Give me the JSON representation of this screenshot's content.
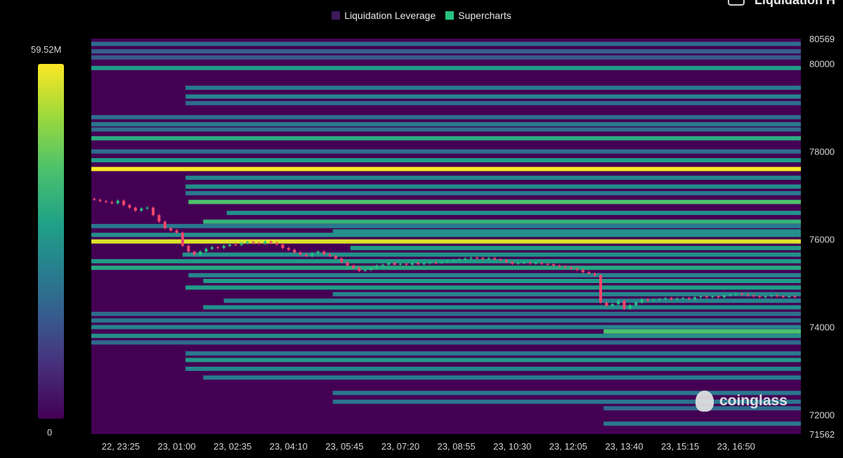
{
  "legend": [
    {
      "label": "Liquidation Leverage",
      "color": "#3d1a5c"
    },
    {
      "label": "Supercharts",
      "color": "#26c281"
    }
  ],
  "corner_title": "Liquidation H",
  "color_scale": {
    "max_label": "59.52M",
    "min_label": "0"
  },
  "watermark": "coinglass",
  "colors": {
    "background": "#440154",
    "candle_up": "#26c281",
    "candle_down": "#f0476b",
    "band_low": "#365c8d",
    "band_mid": "#1fa187",
    "band_high": "#fde725"
  },
  "chart_data": {
    "type": "heatmap",
    "x_ticks": [
      "22, 23:25",
      "23, 01:00",
      "23, 02:35",
      "23, 04:10",
      "23, 05:45",
      "23, 07:20",
      "23, 08:55",
      "23, 10:30",
      "23, 12:05",
      "23, 13:40",
      "23, 15:15",
      "23, 16:50"
    ],
    "y_ticks": [
      80569,
      80000,
      78000,
      76000,
      74000,
      72000,
      71562
    ],
    "ylim": [
      71562,
      80569
    ],
    "x_range_minutes": [
      -50,
      1155
    ],
    "candles_close": [
      [
        -45,
        76900
      ],
      [
        -35,
        76870
      ],
      [
        -25,
        76850
      ],
      [
        -15,
        76820
      ],
      [
        -5,
        76880
      ],
      [
        5,
        76780
      ],
      [
        15,
        76720
      ],
      [
        25,
        76650
      ],
      [
        35,
        76700
      ],
      [
        45,
        76720
      ],
      [
        55,
        76550
      ],
      [
        65,
        76400
      ],
      [
        75,
        76250
      ],
      [
        85,
        76200
      ],
      [
        95,
        76150
      ],
      [
        105,
        75850
      ],
      [
        115,
        75720
      ],
      [
        125,
        75650
      ],
      [
        135,
        75720
      ],
      [
        145,
        75780
      ],
      [
        155,
        75820
      ],
      [
        165,
        75800
      ],
      [
        175,
        75850
      ],
      [
        185,
        75880
      ],
      [
        195,
        75870
      ],
      [
        205,
        75910
      ],
      [
        215,
        75940
      ],
      [
        225,
        75920
      ],
      [
        235,
        75900
      ],
      [
        245,
        75950
      ],
      [
        255,
        75920
      ],
      [
        265,
        75880
      ],
      [
        275,
        75800
      ],
      [
        285,
        75760
      ],
      [
        295,
        75700
      ],
      [
        305,
        75650
      ],
      [
        315,
        75620
      ],
      [
        325,
        75680
      ],
      [
        335,
        75720
      ],
      [
        345,
        75660
      ],
      [
        355,
        75620
      ],
      [
        365,
        75560
      ],
      [
        375,
        75480
      ],
      [
        385,
        75400
      ],
      [
        395,
        75350
      ],
      [
        405,
        75280
      ],
      [
        415,
        75300
      ],
      [
        425,
        75350
      ],
      [
        435,
        75400
      ],
      [
        445,
        75420
      ],
      [
        455,
        75460
      ],
      [
        465,
        75420
      ],
      [
        475,
        75440
      ],
      [
        485,
        75420
      ],
      [
        495,
        75460
      ],
      [
        505,
        75430
      ],
      [
        515,
        75450
      ],
      [
        525,
        75470
      ],
      [
        535,
        75460
      ],
      [
        545,
        75480
      ],
      [
        555,
        75500
      ],
      [
        565,
        75520
      ],
      [
        575,
        75540
      ],
      [
        585,
        75560
      ],
      [
        595,
        75580
      ],
      [
        605,
        75570
      ],
      [
        615,
        75550
      ],
      [
        625,
        75570
      ],
      [
        635,
        75540
      ],
      [
        645,
        75520
      ],
      [
        655,
        75480
      ],
      [
        665,
        75440
      ],
      [
        675,
        75460
      ],
      [
        685,
        75470
      ],
      [
        695,
        75450
      ],
      [
        705,
        75460
      ],
      [
        715,
        75440
      ],
      [
        725,
        75430
      ],
      [
        735,
        75400
      ],
      [
        745,
        75380
      ],
      [
        755,
        75360
      ],
      [
        765,
        75330
      ],
      [
        775,
        75300
      ],
      [
        785,
        75250
      ],
      [
        795,
        75220
      ],
      [
        805,
        75180
      ],
      [
        815,
        74560
      ],
      [
        825,
        74480
      ],
      [
        835,
        74520
      ],
      [
        845,
        74600
      ],
      [
        855,
        74420
      ],
      [
        865,
        74500
      ],
      [
        875,
        74560
      ],
      [
        885,
        74630
      ],
      [
        895,
        74600
      ],
      [
        905,
        74620
      ],
      [
        915,
        74640
      ],
      [
        925,
        74660
      ],
      [
        935,
        74630
      ],
      [
        945,
        74650
      ],
      [
        955,
        74660
      ],
      [
        965,
        74640
      ],
      [
        975,
        74680
      ],
      [
        985,
        74700
      ],
      [
        995,
        74680
      ],
      [
        1005,
        74700
      ],
      [
        1015,
        74680
      ],
      [
        1025,
        74720
      ],
      [
        1035,
        74740
      ],
      [
        1045,
        74760
      ],
      [
        1055,
        74740
      ],
      [
        1065,
        74720
      ],
      [
        1075,
        74700
      ],
      [
        1085,
        74680
      ],
      [
        1095,
        74700
      ],
      [
        1105,
        74720
      ],
      [
        1115,
        74700
      ],
      [
        1125,
        74690
      ],
      [
        1135,
        74700
      ],
      [
        1145,
        74690
      ]
    ],
    "bands": [
      {
        "price": 80450,
        "start": -50,
        "level": 0.35
      },
      {
        "price": 80280,
        "start": -50,
        "level": 0.3
      },
      {
        "price": 80140,
        "start": -50,
        "level": 0.28
      },
      {
        "price": 79900,
        "start": -50,
        "level": 0.55
      },
      {
        "price": 79450,
        "start": 110,
        "level": 0.4
      },
      {
        "price": 79250,
        "start": 110,
        "level": 0.45
      },
      {
        "price": 79100,
        "start": 110,
        "level": 0.35
      },
      {
        "price": 78780,
        "start": -50,
        "level": 0.35
      },
      {
        "price": 78620,
        "start": -50,
        "level": 0.4
      },
      {
        "price": 78500,
        "start": -50,
        "level": 0.35
      },
      {
        "price": 78300,
        "start": -50,
        "level": 0.62
      },
      {
        "price": 78000,
        "start": -50,
        "level": 0.35
      },
      {
        "price": 77800,
        "start": -50,
        "level": 0.55
      },
      {
        "price": 77600,
        "start": -50,
        "level": 1.0
      },
      {
        "price": 77400,
        "start": 110,
        "level": 0.45
      },
      {
        "price": 77200,
        "start": 110,
        "level": 0.5
      },
      {
        "price": 77050,
        "start": 110,
        "level": 0.4
      },
      {
        "price": 76850,
        "start": 115,
        "level": 0.72
      },
      {
        "price": 76600,
        "start": 180,
        "level": 0.5
      },
      {
        "price": 76400,
        "start": 140,
        "level": 0.65
      },
      {
        "price": 76300,
        "start": -50,
        "level": 0.4
      },
      {
        "price": 76180,
        "start": 360,
        "level": 0.5
      },
      {
        "price": 76100,
        "start": -50,
        "level": 0.5
      },
      {
        "price": 75950,
        "start": -50,
        "level": 0.95
      },
      {
        "price": 75800,
        "start": 390,
        "level": 0.55
      },
      {
        "price": 75650,
        "start": 105,
        "level": 0.5
      },
      {
        "price": 75500,
        "start": -50,
        "level": 0.55
      },
      {
        "price": 75350,
        "start": -50,
        "level": 0.6
      },
      {
        "price": 75180,
        "start": 115,
        "level": 0.45
      },
      {
        "price": 75050,
        "start": 140,
        "level": 0.55
      },
      {
        "price": 74900,
        "start": 110,
        "level": 0.55
      },
      {
        "price": 74750,
        "start": 360,
        "level": 0.45
      },
      {
        "price": 74600,
        "start": 175,
        "level": 0.45
      },
      {
        "price": 74450,
        "start": 140,
        "level": 0.5
      },
      {
        "price": 74300,
        "start": -50,
        "level": 0.35
      },
      {
        "price": 74150,
        "start": -50,
        "level": 0.4
      },
      {
        "price": 74000,
        "start": -50,
        "level": 0.45
      },
      {
        "price": 73900,
        "start": 820,
        "level": 0.72
      },
      {
        "price": 73800,
        "start": -50,
        "level": 0.5
      },
      {
        "price": 73650,
        "start": -50,
        "level": 0.35
      },
      {
        "price": 73400,
        "start": 110,
        "level": 0.4
      },
      {
        "price": 73250,
        "start": 110,
        "level": 0.55
      },
      {
        "price": 73050,
        "start": 110,
        "level": 0.45
      },
      {
        "price": 72850,
        "start": 140,
        "level": 0.4
      },
      {
        "price": 72500,
        "start": 360,
        "level": 0.4
      },
      {
        "price": 72300,
        "start": 360,
        "level": 0.38
      },
      {
        "price": 72150,
        "start": 820,
        "level": 0.35
      },
      {
        "price": 71800,
        "start": 820,
        "level": 0.4
      }
    ]
  }
}
